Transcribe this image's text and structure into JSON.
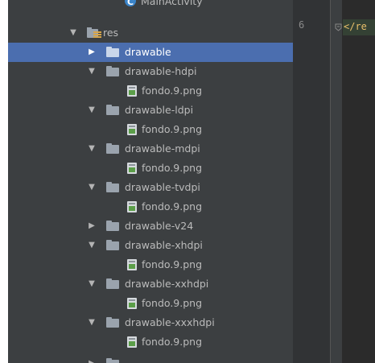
{
  "tree": {
    "partial_top": "MainActivity",
    "res_label": "res",
    "items": [
      {
        "label": "drawable",
        "expanded": false,
        "selected": true,
        "type": "folder"
      },
      {
        "label": "drawable-hdpi",
        "expanded": true,
        "type": "folder"
      },
      {
        "label": "fondo.9.png",
        "type": "file"
      },
      {
        "label": "drawable-ldpi",
        "expanded": true,
        "type": "folder"
      },
      {
        "label": "fondo.9.png",
        "type": "file"
      },
      {
        "label": "drawable-mdpi",
        "expanded": true,
        "type": "folder"
      },
      {
        "label": "fondo.9.png",
        "type": "file"
      },
      {
        "label": "drawable-tvdpi",
        "expanded": true,
        "type": "folder"
      },
      {
        "label": "fondo.9.png",
        "type": "file"
      },
      {
        "label": "drawable-v24",
        "expanded": false,
        "type": "folder"
      },
      {
        "label": "drawable-xhdpi",
        "expanded": true,
        "type": "folder"
      },
      {
        "label": "fondo.9.png",
        "type": "file"
      },
      {
        "label": "drawable-xxhdpi",
        "expanded": true,
        "type": "folder"
      },
      {
        "label": "fondo.9.png",
        "type": "file"
      },
      {
        "label": "drawable-xxxhdpi",
        "expanded": true,
        "type": "folder"
      },
      {
        "label": "fondo.9.png",
        "type": "file"
      }
    ]
  },
  "editor": {
    "line_number": "6",
    "code": "</re"
  },
  "colors": {
    "panel_bg": "#3c3f41",
    "selection": "#4b6eaf",
    "editor_bg": "#2b2b2b",
    "tag_color": "#e8bf6a"
  },
  "icons": {
    "folder": "folder-icon",
    "file": "png-file-icon",
    "expanded": "chevron-down-icon",
    "collapsed": "chevron-right-icon"
  }
}
